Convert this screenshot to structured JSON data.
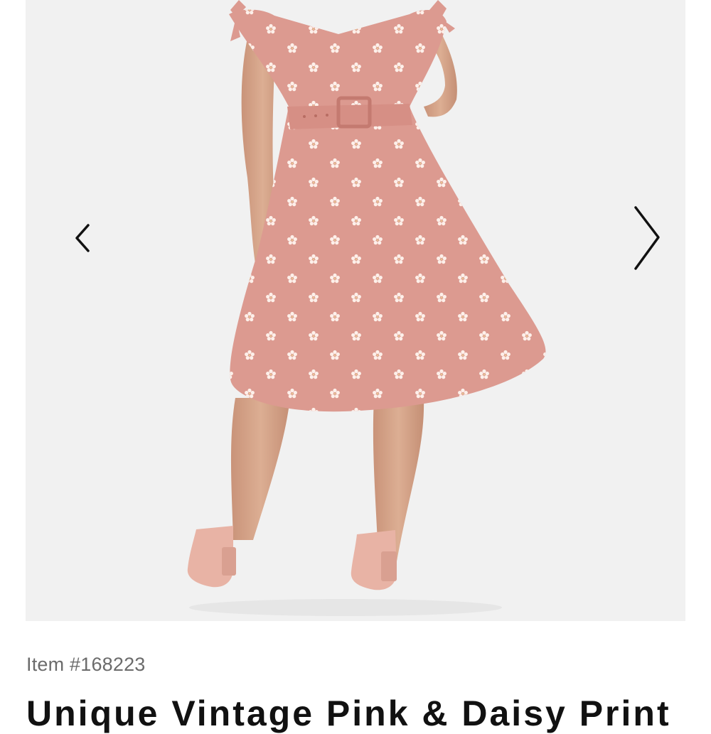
{
  "product": {
    "item_number": "Item #168223",
    "title": "Unique Vintage Pink & Daisy Print"
  },
  "gallery": {
    "prev_icon": "chevron-left-icon",
    "next_icon": "chevron-right-icon",
    "image_subject": "model wearing pink daisy print swing dress"
  },
  "colors": {
    "dress": "#dc9a90",
    "daisy": "#fdf0ea",
    "background": "#f1f1f1",
    "title": "#111111",
    "item_number": "#6b6b6b"
  }
}
